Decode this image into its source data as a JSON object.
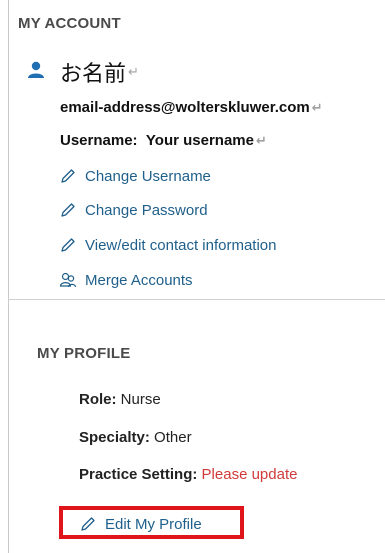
{
  "account": {
    "title": "MY ACCOUNT",
    "name": "お名前",
    "email": "email-address@wolterskluwer.com",
    "username_label": "Username:",
    "username_value": "Your username",
    "links": [
      {
        "label": "Change Username",
        "icon": "pencil-icon"
      },
      {
        "label": "Change Password",
        "icon": "pencil-icon"
      },
      {
        "label": "View/edit contact information",
        "icon": "pencil-icon"
      },
      {
        "label": "Merge Accounts",
        "icon": "merge-accounts-icon"
      }
    ]
  },
  "profile": {
    "title": "MY PROFILE",
    "role_label": "Role:",
    "role_value": "Nurse",
    "specialty_label": "Specialty:",
    "specialty_value": "Other",
    "practice_label": "Practice Setting:",
    "practice_value": "Please update",
    "edit_label": "Edit My Profile"
  },
  "colors": {
    "link": "#1f5f8b",
    "warning": "#d13a3a",
    "highlight": "#e0151b",
    "avatar": "#1f6fb2"
  }
}
